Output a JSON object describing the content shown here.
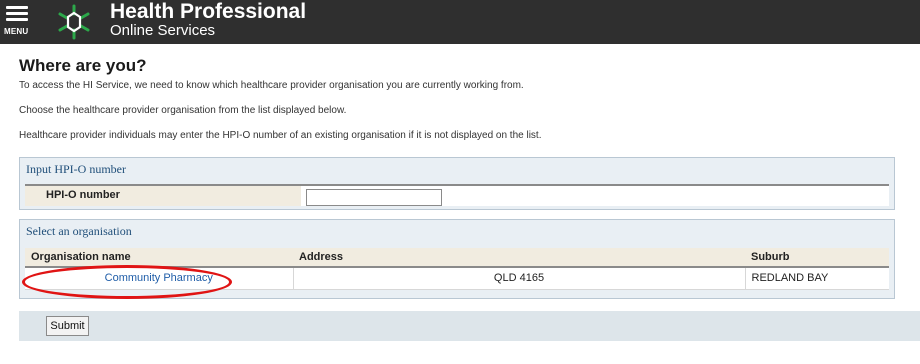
{
  "header": {
    "menu_label": "MENU",
    "brand_title": "Health Professional",
    "brand_subtitle": "Online Services",
    "brand_color": "#2f2f2f"
  },
  "main": {
    "title": "Where are you?",
    "paragraphs": [
      "To access the HI Service, we need to know which healthcare provider organisation you are currently working from.",
      "Choose the healthcare provider organisation from the list displayed below.",
      "Healthcare provider individuals may enter the HPI-O number of an existing organisation if it is not displayed on the list."
    ]
  },
  "hpio": {
    "section_title": "Input HPI-O number",
    "field_label": "HPI-O number",
    "value": ""
  },
  "organisations": {
    "section_title": "Select an organisation",
    "columns": [
      "Organisation name",
      "Address",
      "Suburb"
    ],
    "rows": [
      {
        "name": "Community Pharmacy",
        "address": "QLD 4165",
        "suburb": "REDLAND BAY"
      }
    ]
  },
  "actions": {
    "submit_label": "Submit"
  },
  "icons": {
    "menu": "hamburger-menu-icon",
    "logo": "hpos-star-logo-icon"
  },
  "colors": {
    "link": "#1f5da8",
    "highlight": "#e01414",
    "section_title": "#1f4e79"
  }
}
